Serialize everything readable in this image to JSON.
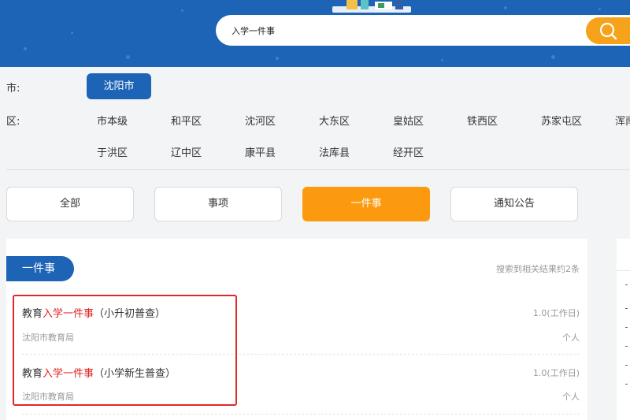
{
  "colors": {
    "header_blue": "#1d63b6",
    "accent_orange": "#fb9a0e",
    "search_button": "#f7a21b",
    "highlight_red": "#e02020",
    "annotation_red": "#e02828"
  },
  "search": {
    "value": "入学一件事",
    "button_icon": "search-icon"
  },
  "filters": {
    "city_label": "市:",
    "city_selected": "沈阳市",
    "district_label": "区:",
    "districts_row1": [
      "市本级",
      "和平区",
      "沈河区",
      "大东区",
      "皇姑区",
      "铁西区",
      "苏家屯区",
      "浑南"
    ],
    "districts_row2": [
      "于洪区",
      "辽中区",
      "康平县",
      "法库县",
      "经开区"
    ]
  },
  "tabs": [
    {
      "label": "全部",
      "active": false
    },
    {
      "label": "事项",
      "active": false
    },
    {
      "label": "一件事",
      "active": true
    },
    {
      "label": "通知公告",
      "active": false
    }
  ],
  "results": {
    "section_title": "一件事",
    "count_text": "搜索到相关结果约2条",
    "items": [
      {
        "title_prefix": "教育",
        "title_highlight": "入学一件事",
        "title_suffix": "（小升初普查）",
        "department": "沈阳市教育局",
        "time_limit": "1.0(工作日)",
        "audience": "个人"
      },
      {
        "title_prefix": "教育",
        "title_highlight": "入学一件事",
        "title_suffix": "（小学新生普查）",
        "department": "沈阳市教育局",
        "time_limit": "1.0(工作日)",
        "audience": "个人"
      }
    ]
  }
}
